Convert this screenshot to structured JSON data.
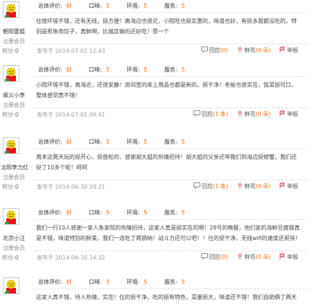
{
  "labels": {
    "overall": "总体评价:",
    "taste": "口味:",
    "env": "环境:",
    "service": "服务:",
    "published_prefix": "发布于",
    "reply": "回应",
    "flower": "鲜花",
    "report": "举报",
    "level": "注册会员",
    "points_label": "积分:"
  },
  "colors": {
    "accent": "#ff6600",
    "border": "#dddddd"
  },
  "reviews": [
    {
      "user": "朝阳雷姐",
      "points": "0",
      "overall": "好",
      "taste": "5",
      "env": "5",
      "service": "5",
      "text": "住宿环境不错，还有无线，挺方便！离海边也很近。小院吃也挺实惠的，味道也好，有挺多我都没吃的，特别是那鱼肉饺子，真鲜啊，比城店做的还好吃！赞一个",
      "date": "2014-07-02 12:43",
      "replies": "(0)",
      "flowers": "(0 朵)"
    },
    {
      "user": "顺义小李",
      "points": "0",
      "overall": "好",
      "taste": "5",
      "env": "5",
      "service": "5",
      "text": "小院环境不错，离海近，还很安静！房间里的床上用品也都是新的，挺干净！老板也很实在，饭菜挺可口，整体感觉真不错！",
      "date": "2014-07-01 09:41",
      "replies": "(1 条)",
      "flowers": "(0 朵)"
    },
    {
      "user": "沈阳李力红",
      "points": "0",
      "overall": "好",
      "taste": "5",
      "env": "5",
      "service": "5",
      "text": "周末这两天玩的挺开心，挺放松的，感谢胡大姐的热情招待！胡大姐的父亲还带我们到海边捉螃蟹，我们还捉了10多个呢！呵呵",
      "date": "2014-06-30 20:21",
      "replies": "(1 条)",
      "flowers": "(0 朵)"
    },
    {
      "user": "北京小汪",
      "points": "0",
      "overall": "好",
      "taste": "5",
      "env": "5",
      "service": "5",
      "text": "我们一行10人感谢一家人鱼家院的热情招待，这家人真是挺实在的啊！28号的晚餐，他们家的海鲜豆腐锅真是不错，味道特别的鲜美，我们一连吃了两锅呐！战斗力还可以吧！！住的挺干净、无线wifi的速度还挺快！",
      "date": "2014-06-30 14:32",
      "replies": "(0)",
      "flowers": "(0 朵)"
    },
    {
      "user": "",
      "points": "",
      "overall": "好",
      "taste": "5",
      "env": "5",
      "service": "5",
      "text": "这家人真不错，待人热情、实在！住的挺干净，吃的挺有特色，菜量挺大，味道还不错！我们自助俩了两天",
      "date": "",
      "replies": "",
      "flowers": ""
    }
  ]
}
